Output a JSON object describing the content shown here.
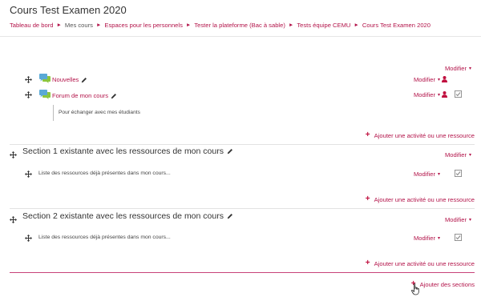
{
  "page": {
    "title": "Cours Test Examen 2020"
  },
  "breadcrumb": {
    "items": [
      "Tableau de bord",
      "Mes cours",
      "Espaces pour les personnels",
      "Tester la plateforme (Bac à sable)",
      "Tests équipe CEMU",
      "Cours Test Examen 2020"
    ],
    "separator": "►"
  },
  "labels": {
    "modifier": "Modifier",
    "caret": "▾",
    "add_activity": "Ajouter une activité ou une ressource",
    "add_sections": "Ajouter des sections",
    "plus": "+"
  },
  "general_section": {
    "activities": [
      {
        "name": "Nouvelles",
        "icon": "forum-icon",
        "has_check": false
      },
      {
        "name": "Forum de mon cours",
        "icon": "forum-icon",
        "has_check": true,
        "description": "Pour échanger avec mes étudiants"
      }
    ]
  },
  "sections": [
    {
      "title": "Section 1 existante avec les ressources de mon cours",
      "resource": "Liste des ressources déjà présentes dans mon cours..."
    },
    {
      "title": "Section 2 existante avec les ressources de mon cours",
      "resource": "Liste des ressources déjà présentes dans mon cours..."
    }
  ],
  "colors": {
    "accent": "#b3144a",
    "plus": "#c0103f",
    "last_separator": "#c8427a"
  }
}
